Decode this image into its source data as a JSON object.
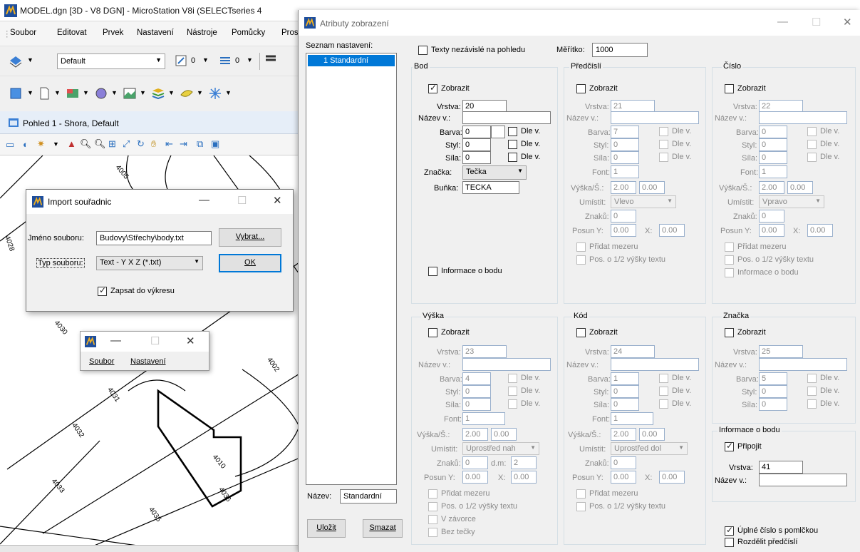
{
  "ms_window": {
    "title": "MODEL.dgn [3D - V8 DGN] - MicroStation V8i (SELECTseries 4",
    "menu": [
      "Soubor",
      "Editovat",
      "Prvek",
      "Nastavení",
      "Nástroje",
      "Pomůcky",
      "Pros"
    ],
    "level_combo": "Default",
    "weight_value_1": "0",
    "weight_value_2": "0",
    "view_title": "Pohled 1 - Shora, Default",
    "canvas_labels": [
      "4005",
      "4028",
      "4030",
      "4031",
      "4002",
      "4032",
      "4010",
      "4033",
      "4036",
      "4035"
    ]
  },
  "import_dialog": {
    "title": "Import souřadnic",
    "filename_label": "Jméno souboru:",
    "filename_value": "Budovy\\Střechy\\body.txt",
    "browse_button": "Vybrat...",
    "filetype_label": "Typ souboru:",
    "filetype_value": "Text - Y X Z (*.txt)",
    "ok_button": "OK",
    "write_checkbox": "Zapsat do výkresu"
  },
  "mini_window": {
    "menu": [
      "Soubor",
      "Nastavení"
    ]
  },
  "attr_dialog": {
    "title": "Atributy zobrazení",
    "list_label": "Seznam nastavení:",
    "list_items": [
      "1 Standardní"
    ],
    "name_label": "Název:",
    "name_value": "Standardní",
    "save_button": "Uložit",
    "delete_button": "Smazat",
    "independent_text_label": "Texty nezávislé na pohledu",
    "scale_label": "Měřítko:",
    "scale_value": "1000",
    "labels": {
      "zobrazit": "Zobrazit",
      "vrstva": "Vrstva:",
      "nazev_v": "Název v.:",
      "barva": "Barva:",
      "styl": "Styl:",
      "sila": "Síla:",
      "dle_v": "Dle v.",
      "font": "Font:",
      "vyska_s": "Výška/Š.:",
      "umistit": "Umístit:",
      "znaku": "Znaků:",
      "dm": "d.m:",
      "posun_y": "Posun Y:",
      "x": "X:",
      "pridat_mezeru": "Přidat mezeru",
      "pos_half": "Pos. o 1/2 výšky textu",
      "informace_o_bodu": "Informace o bodu",
      "znacka": "Značka:",
      "bunka": "Buňka:"
    },
    "bod": {
      "title": "Bod",
      "vrstva": "20",
      "nazev": "",
      "barva": "0",
      "styl": "0",
      "sila": "0",
      "znacka": "Tečka",
      "bunka": "TECKA"
    },
    "predcisli": {
      "title": "Předčíslí",
      "vrstva": "21",
      "barva": "7",
      "styl": "0",
      "sila": "0",
      "font": "1",
      "vyska": "2.00",
      "sirka": "0.00",
      "umistit": "Vlevo",
      "znaku": "0",
      "posun_y": "0.00",
      "x": "0.00"
    },
    "cislo": {
      "title": "Číslo",
      "vrstva": "22",
      "barva": "0",
      "styl": "0",
      "sila": "0",
      "font": "1",
      "vyska": "2.00",
      "sirka": "0.00",
      "umistit": "Vpravo",
      "znaku": "0",
      "posun_y": "0.00",
      "x": "0.00"
    },
    "vyska": {
      "title": "Výška",
      "vrstva": "23",
      "barva": "4",
      "styl": "0",
      "sila": "0",
      "font": "1",
      "vyska": "2.00",
      "sirka": "0.00",
      "umistit": "Uprostřed nah",
      "znaku": "0",
      "dm": "2",
      "posun_y": "0.00",
      "x": "0.00",
      "v_zavorce": "V závorce",
      "bez_tecky": "Bez tečky"
    },
    "kod": {
      "title": "Kód",
      "vrstva": "24",
      "barva": "1",
      "styl": "0",
      "sila": "0",
      "font": "1",
      "vyska": "2.00",
      "sirka": "0.00",
      "umistit": "Uprostřed dol",
      "znaku": "0",
      "posun_y": "0.00",
      "x": "0.00"
    },
    "znacka": {
      "title": "Značka",
      "vrstva": "25",
      "barva": "5",
      "styl": "0",
      "sila": "0"
    },
    "info": {
      "title": "Informace o bodu",
      "pripojit": "Připojit",
      "vrstva": "41",
      "nazev": ""
    },
    "full_number": "Úplné číslo s pomlčkou",
    "split_prefix": "Rozdělit předčíslí"
  },
  "colors": {
    "accent": "#0078d7",
    "window_bg": "#f0f0f0",
    "disabled_border": "#9ab0cc"
  }
}
